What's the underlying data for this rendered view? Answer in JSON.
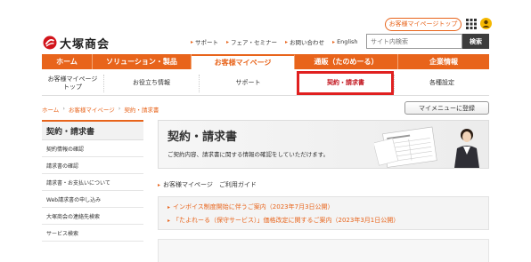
{
  "header": {
    "mypage_top_label": "お客様マイページトップ",
    "logo_text": "大塚商会",
    "utility_links": [
      "サポート",
      "フェア・セミナー",
      "お問い合わせ",
      "English"
    ],
    "search": {
      "placeholder": "サイト内検索",
      "button_label": "検索"
    }
  },
  "global_nav": {
    "items": [
      "ホーム",
      "ソリューション・製品",
      "お客様マイページ",
      "通販（たのめーる）",
      "企業情報"
    ],
    "active_index": 2
  },
  "sub_nav": {
    "items": [
      {
        "label": "お客様マイページ\nトップ"
      },
      {
        "label": "お役立ち情報"
      },
      {
        "label": "サポート"
      },
      {
        "label": "契約・請求書"
      },
      {
        "label": "各種設定"
      }
    ],
    "highlighted_index": 3
  },
  "breadcrumb": {
    "items": [
      "ホーム",
      "お客様マイページ",
      "契約・請求書"
    ]
  },
  "mymenu_button_label": "マイメニューに登録",
  "sidebar": {
    "title": "契約・請求書",
    "items": [
      "契約情報の確認",
      "請求書の確認",
      "請求書・お支払いについて",
      "Web請求書の申し込み",
      "大塚商会の連絡先検索",
      "サービス検索"
    ]
  },
  "banner": {
    "title": "契約・請求書",
    "description": "ご契約内容、請求書に関する情報の確認をしていただけます。"
  },
  "guide_link": "お客様マイページ　ご利用ガイド",
  "notices": [
    "インボイス制度開始に伴うご案内（2023年7月3日公開）",
    "「たよれーる（保守サービス）」価格改定に関するご案内（2023年3月1日公開）"
  ],
  "colors": {
    "brand_orange": "#e8641b",
    "highlight_red": "#e02020",
    "search_button": "#3d3d3d"
  }
}
